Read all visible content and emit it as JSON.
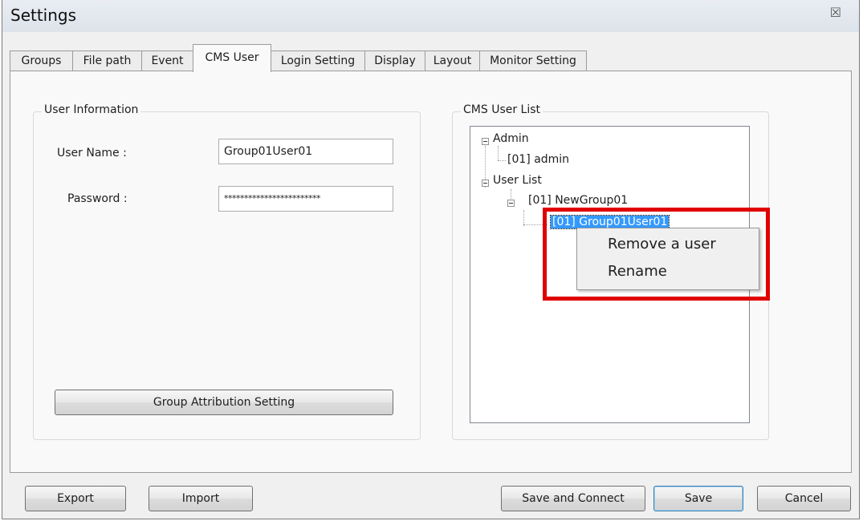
{
  "window": {
    "title": "Settings",
    "close_glyph": "☒"
  },
  "tabs": [
    {
      "label": "Groups",
      "active": false
    },
    {
      "label": "File path",
      "active": false
    },
    {
      "label": "Event",
      "active": false
    },
    {
      "label": "CMS User",
      "active": true
    },
    {
      "label": "Login Setting",
      "active": false
    },
    {
      "label": "Display",
      "active": false
    },
    {
      "label": "Layout",
      "active": false
    },
    {
      "label": "Monitor Setting",
      "active": false
    }
  ],
  "user_info": {
    "group_label": "User Information",
    "username_label": "User Name :",
    "username_value": "Group01User01",
    "password_label": "Password :",
    "password_value": "************************",
    "group_attr_button": "Group Attribution Setting"
  },
  "user_list": {
    "group_label": "CMS User List",
    "tree": {
      "admin": "Admin",
      "admin_user": "[01] admin",
      "user_list": "User List",
      "group": "[01] NewGroup01",
      "selected_user": "[01] Group01User01"
    }
  },
  "context_menu": {
    "items": [
      "Remove a user",
      "Rename"
    ]
  },
  "annotation": {
    "highlight_color": "#e00000"
  },
  "footer": {
    "export": "Export",
    "import": "Import",
    "save_connect": "Save and Connect",
    "save": "Save",
    "cancel": "Cancel"
  }
}
